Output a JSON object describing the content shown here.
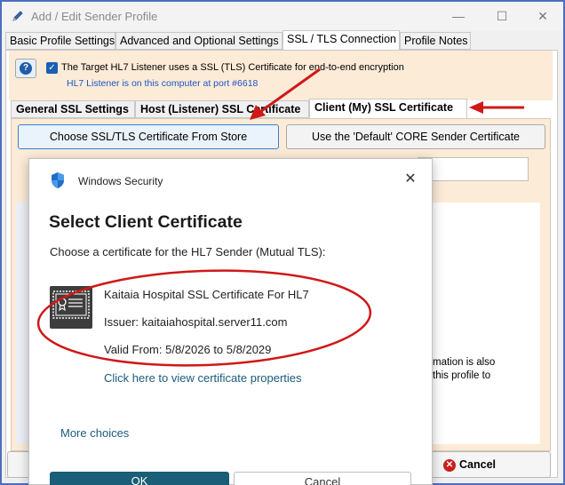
{
  "window": {
    "title": "Add / Edit Sender Profile",
    "buttons": {
      "minimize": "—",
      "maximize": "☐",
      "close": "✕"
    }
  },
  "top_tabs": [
    {
      "label": "Basic Profile Settings"
    },
    {
      "label": "Advanced and Optional Settings"
    },
    {
      "label": "SSL / TLS Connection",
      "active": true
    },
    {
      "label": "Profile Notes"
    }
  ],
  "ssl_header": {
    "checkbox_label": "The Target HL7 Listener uses a SSL (TLS) Certificate for end-to-end encryption",
    "checked": true,
    "sub_note": "HL7 Listener is on this computer at port #6618"
  },
  "sub_tabs": [
    {
      "label": "General SSL Settings"
    },
    {
      "label": "Host (Listener) SSL Certificate"
    },
    {
      "label": "Client (My) SSL Certificate",
      "active": true
    }
  ],
  "buttons": {
    "choose_cert": "Choose SSL/TLS Certificate From Store",
    "use_default": "Use the 'Default' CORE Sender Certificate",
    "cancel": "Cancel"
  },
  "side_text": {
    "line1": "mation is also",
    "line2": "this profile to"
  },
  "dialog": {
    "app_label": "Windows Security",
    "heading": "Select Client Certificate",
    "description": "Choose a certificate for the HL7 Sender (Mutual TLS):",
    "certificate": {
      "name": "Kaitaia Hospital SSL Certificate For HL7",
      "issuer": "Issuer: kaitaiahospital.server11.com",
      "valid": "Valid From: 5/8/2026 to 5/8/2029"
    },
    "properties_link": "Click here to view certificate properties",
    "more_choices": "More choices",
    "ok_label": "OK",
    "cancel_label": "Cancel"
  },
  "colors": {
    "accent": "#1a5e78",
    "annotation": "#d01818",
    "beige": "#fcebd7",
    "link": "#1a5c7a",
    "frame": "#4a6ec4"
  },
  "icons": {
    "title": "pencil-icon",
    "help": "question-icon",
    "dialog": "shield-icon",
    "certificate": "certificate-icon",
    "cancel": "cancel-icon"
  }
}
